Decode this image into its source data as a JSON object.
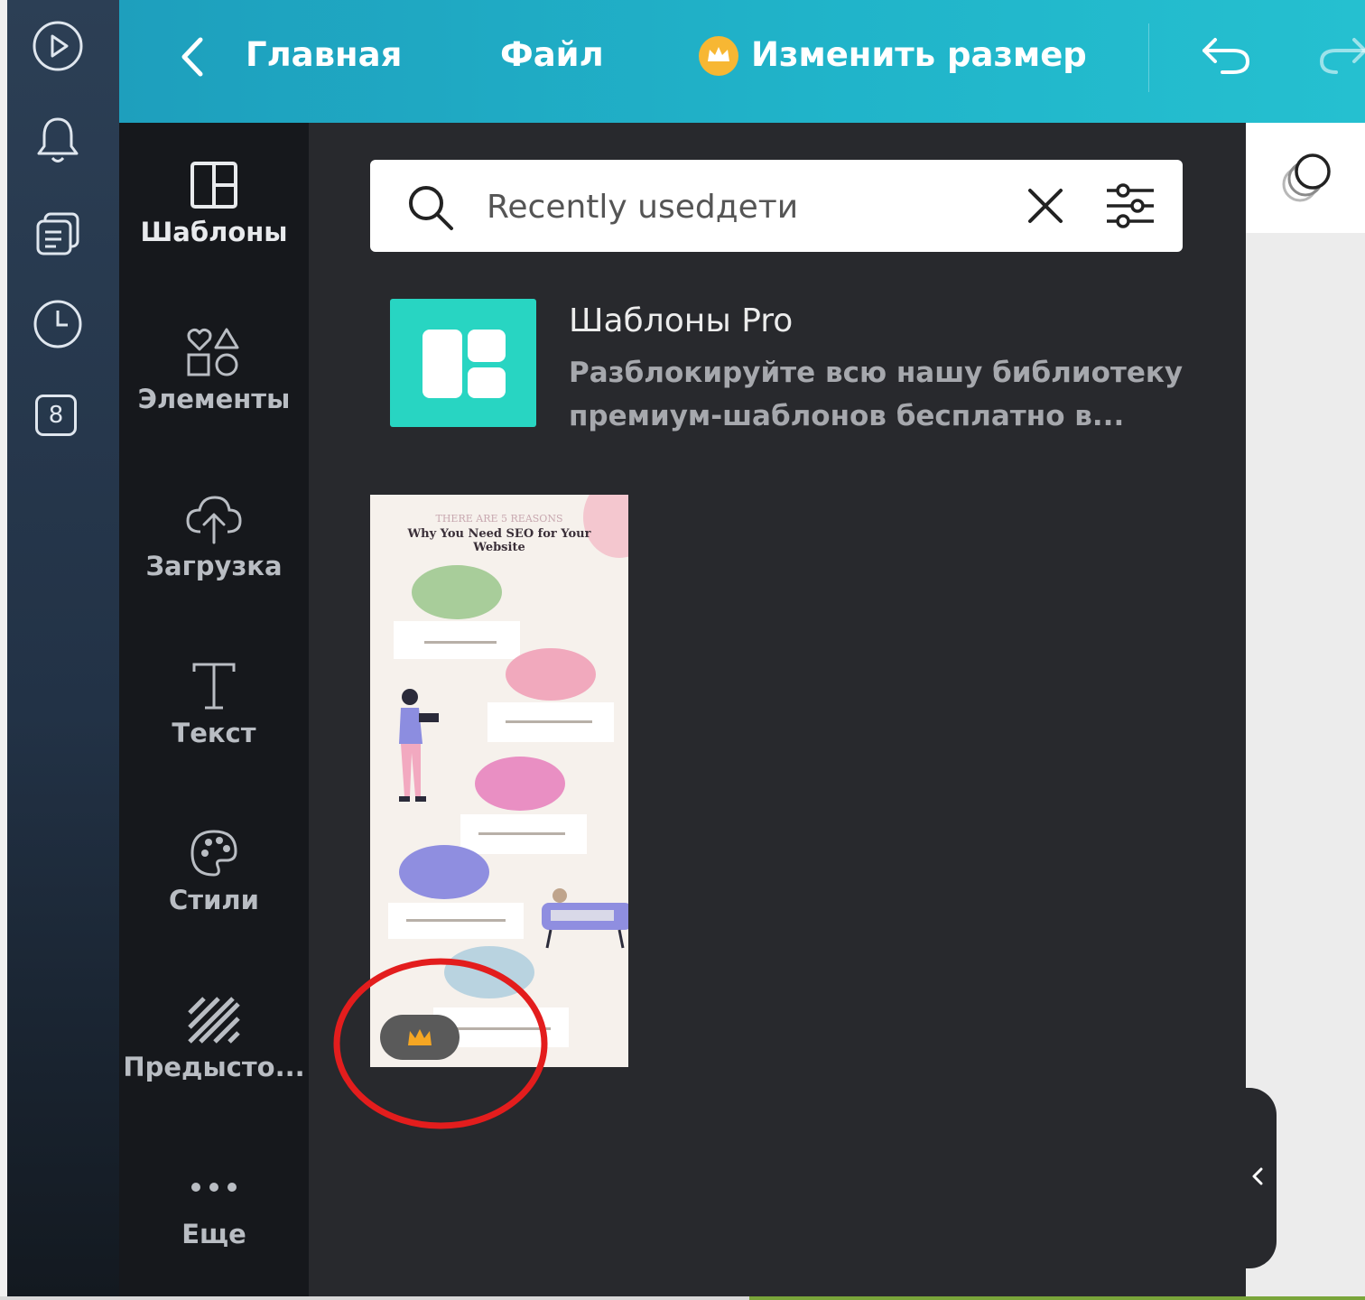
{
  "header": {
    "back_icon": "chevron-left-icon",
    "home_label": "Главная",
    "file_label": "Файл",
    "resize_label": "Изменить размер",
    "undo_icon": "undo-icon",
    "redo_icon": "redo-icon",
    "accent": "#20b3c9"
  },
  "rail": {
    "items": [
      {
        "icon": "play-icon"
      },
      {
        "icon": "bell-icon"
      },
      {
        "icon": "pages-icon"
      },
      {
        "icon": "clock-icon"
      },
      {
        "icon": "counter-badge",
        "value": "8"
      }
    ]
  },
  "tabs": {
    "items": [
      {
        "label": "Шаблоны",
        "icon": "templates-icon"
      },
      {
        "label": "Элементы",
        "icon": "elements-icon"
      },
      {
        "label": "Загрузка",
        "icon": "upload-icon"
      },
      {
        "label": "Текст",
        "icon": "text-icon"
      },
      {
        "label": "Стили",
        "icon": "palette-icon"
      },
      {
        "label": "Предысто...",
        "icon": "background-icon"
      },
      {
        "label": "Еще",
        "icon": "more-icon"
      }
    ]
  },
  "search": {
    "value": "Recently usedдети",
    "placeholder": "Recently usedдети"
  },
  "pro": {
    "title": "Шаблоны Pro",
    "description": "Разблокируйте всю нашу библиотеку премиум-шаблонов бесплатно в...",
    "color": "#28d5c2"
  },
  "template": {
    "subtitle": "THERE ARE 5 REASONS",
    "title": "Why You Need SEO for Your Website",
    "badge_icon": "crown-icon"
  }
}
